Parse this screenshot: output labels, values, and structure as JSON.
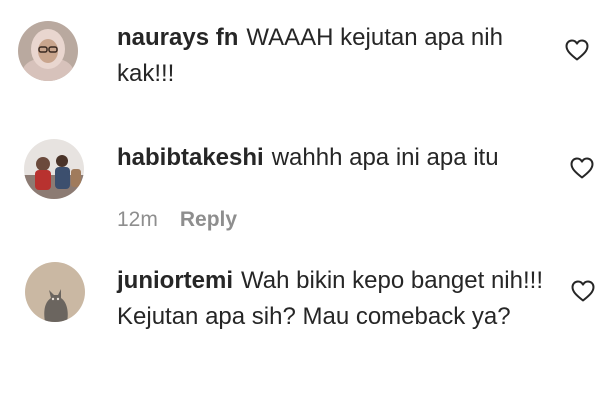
{
  "comments": [
    {
      "username": "naurays fn",
      "text": "WAAAH kejutan apa nih kak!!!",
      "avatar_icon": "hijab-woman-avatar",
      "liked": false
    },
    {
      "username": "habibtakeshi",
      "text": "wahhh apa ini apa itu",
      "avatar_icon": "group-photo-avatar",
      "time": "12m",
      "reply_label": "Reply",
      "liked": false
    },
    {
      "username": "juniortemi",
      "text": "Wah bikin kepo banget nih!!! Kejutan apa sih? Mau comeback ya?",
      "avatar_icon": "cat-silhouette-avatar",
      "liked": false
    }
  ],
  "colors": {
    "text": "#262626",
    "muted": "#8e8e8e",
    "heart_outline": "#262626"
  }
}
